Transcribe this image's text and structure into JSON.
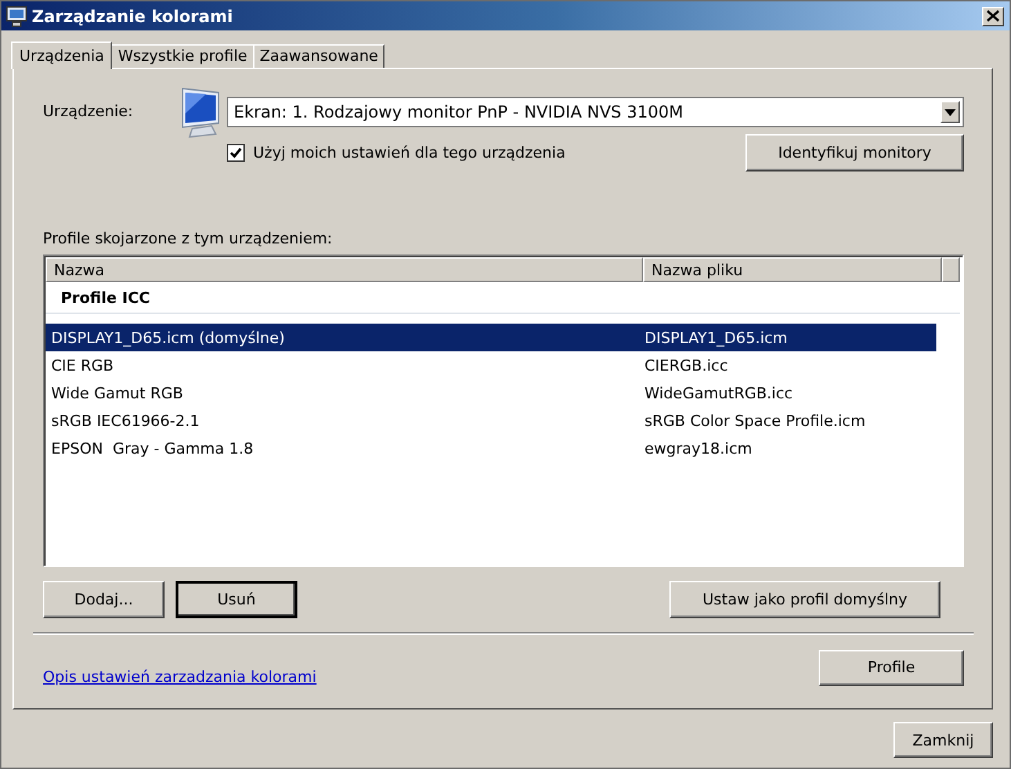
{
  "window": {
    "title": "Zarządzanie kolorami"
  },
  "tabs": [
    {
      "label": "Urządzenia",
      "selected": true
    },
    {
      "label": "Wszystkie profile",
      "selected": false
    },
    {
      "label": "Zaawansowane",
      "selected": false
    }
  ],
  "device": {
    "label": "Urządzenie:",
    "value": "Ekran: 1. Rodzajowy monitor PnP - NVIDIA NVS 3100M"
  },
  "use_my_settings": {
    "label": "Użyj moich ustawień dla tego urządzenia",
    "checked": true
  },
  "identify_button": "Identyfikuj monitory",
  "profiles_label": "Profile skojarzone z tym urządzeniem:",
  "table": {
    "columns": [
      "Nazwa",
      "Nazwa pliku"
    ],
    "group": "Profile ICC",
    "rows": [
      {
        "name": "DISPLAY1_D65.icm (domyślne)",
        "file": "DISPLAY1_D65.icm",
        "selected": true
      },
      {
        "name": "CIE RGB",
        "file": "CIERGB.icc",
        "selected": false
      },
      {
        "name": "Wide Gamut RGB",
        "file": "WideGamutRGB.icc",
        "selected": false
      },
      {
        "name": "sRGB IEC61966-2.1",
        "file": "sRGB Color Space Profile.icm",
        "selected": false
      },
      {
        "name": "EPSON  Gray - Gamma 1.8",
        "file": "ewgray18.icm",
        "selected": false
      }
    ]
  },
  "list_buttons": [
    {
      "label": "Dodaj...",
      "default": false
    },
    {
      "label": "Usuń",
      "default": true
    }
  ],
  "set_default_button": "Ustaw jako profil domyślny",
  "help_link": "Opis ustawień zarzadzania kolorami",
  "profile_button": "Profile",
  "close_button": "Zamknij"
}
